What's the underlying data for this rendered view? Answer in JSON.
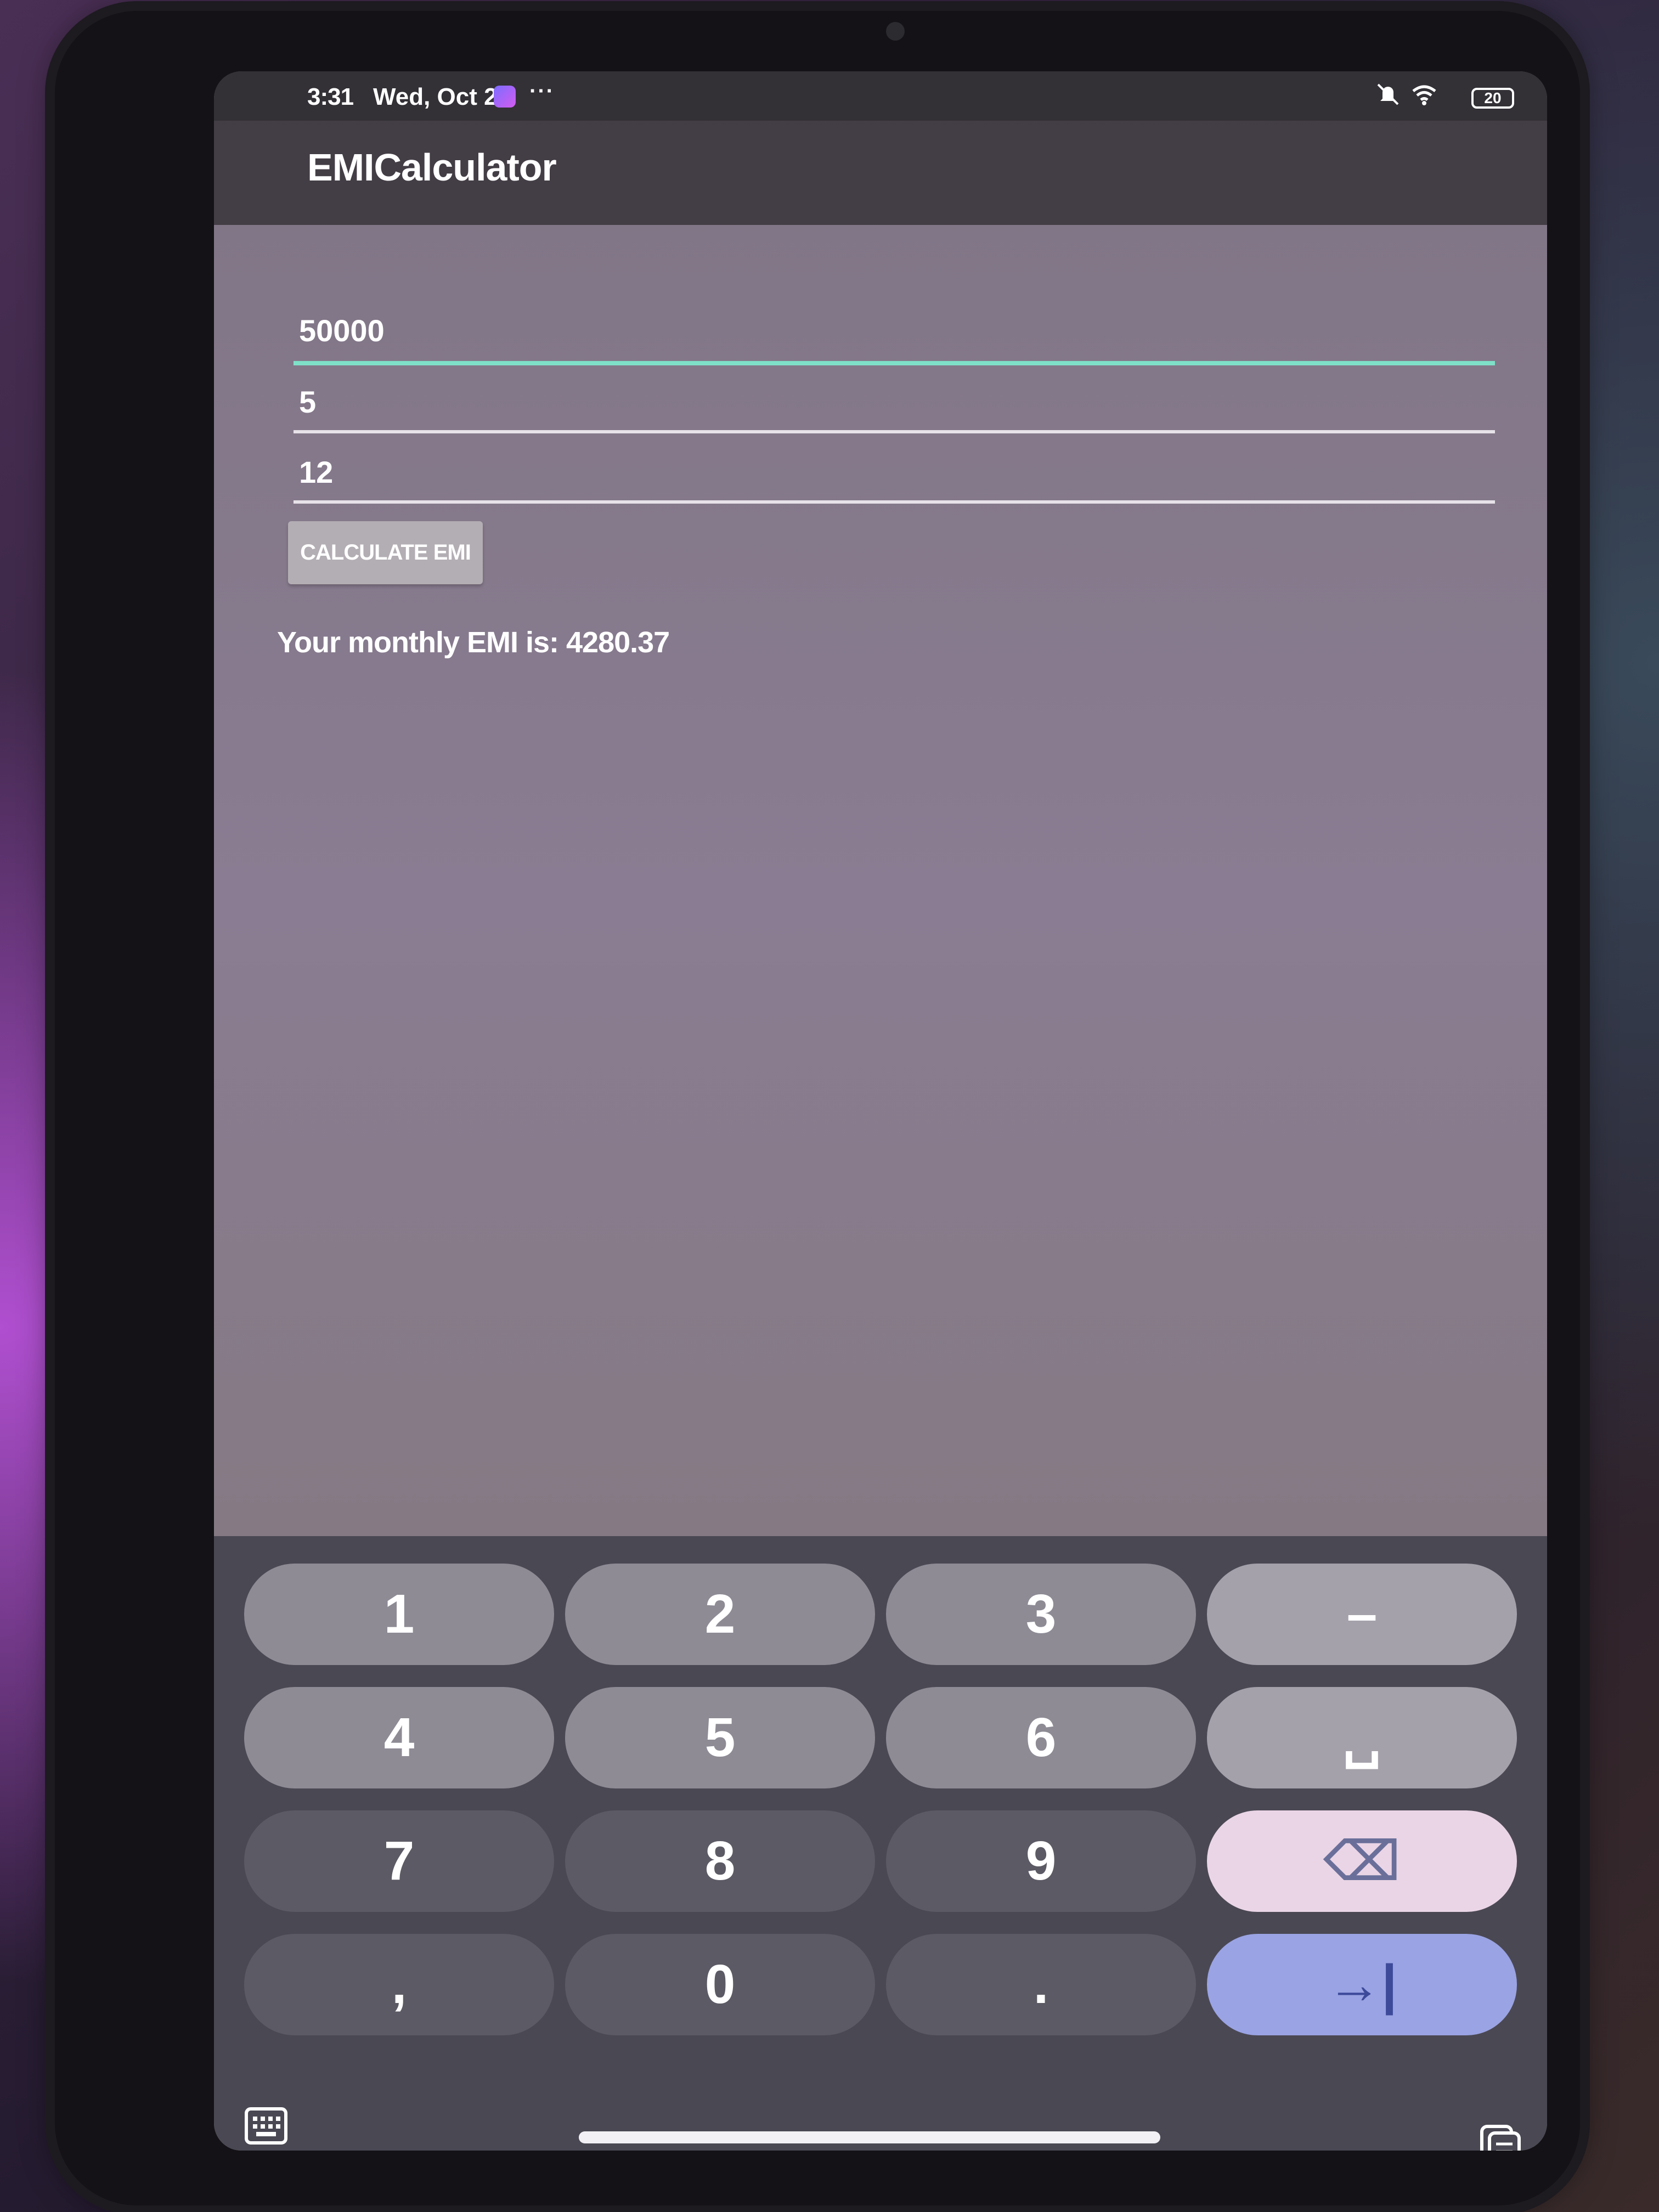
{
  "statusbar": {
    "time": "3:31",
    "date": "Wed, Oct 2",
    "more": "···",
    "battery": "20",
    "icons": [
      "mute-icon",
      "wifi-icon",
      "battery-icon",
      "messenger-icon"
    ]
  },
  "app": {
    "title": "EMICalculator"
  },
  "form": {
    "principal_value": "50000",
    "rate_value": "5",
    "tenure_value": "12",
    "calculate_label": "CALCULATE EMI",
    "result_text": "Your monthly EMI is: 4280.37"
  },
  "keyboard": {
    "rows": [
      [
        "1",
        "2",
        "3",
        "–"
      ],
      [
        "4",
        "5",
        "6",
        "␣"
      ],
      [
        "7",
        "8",
        "9",
        "⌫"
      ],
      [
        ",",
        "0",
        ".",
        "→|"
      ]
    ],
    "icons": [
      "keyboard-switch-icon",
      "clipboard-icon",
      "backspace-icon",
      "tab-icon",
      "space-icon"
    ]
  },
  "colors": {
    "focus_underline": "#7fe0c8",
    "delete_key": "#ead5e6",
    "enter_key": "#9aa3e3"
  }
}
